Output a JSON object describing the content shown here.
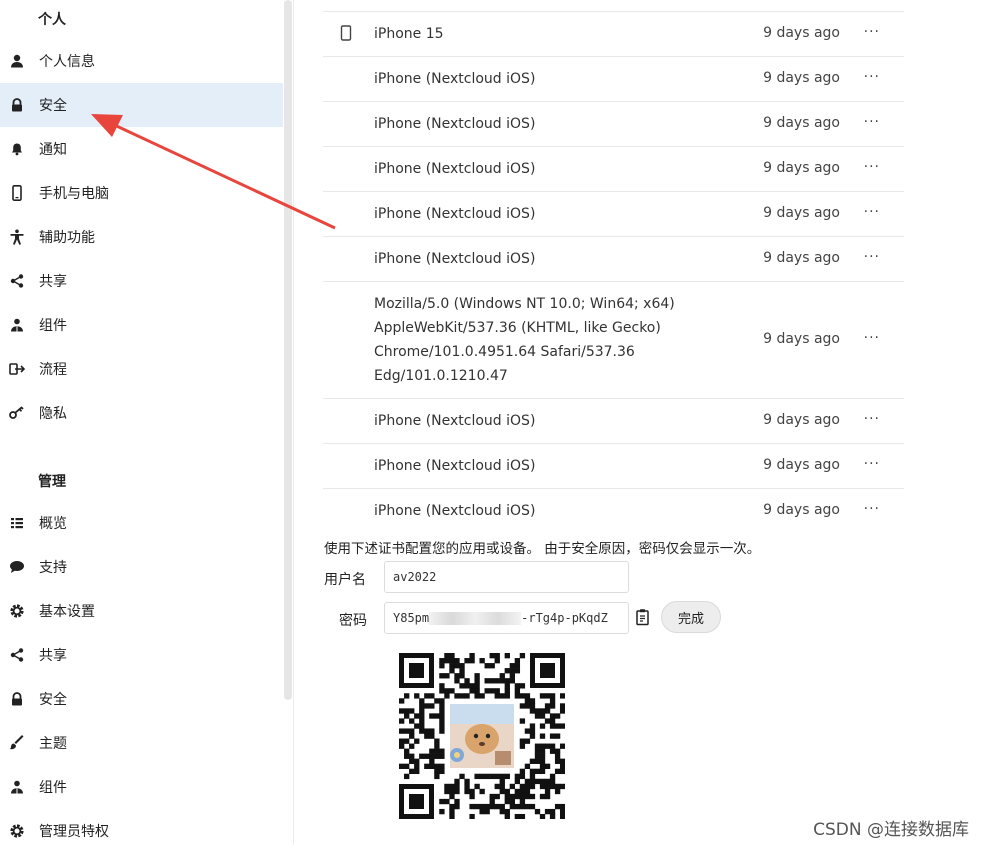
{
  "sidebar": {
    "personal_heading": "个人",
    "personal_items": [
      {
        "label": "个人信息",
        "icon": "user-icon"
      },
      {
        "label": "安全",
        "icon": "lock-icon",
        "active": true
      },
      {
        "label": "通知",
        "icon": "bell-icon"
      },
      {
        "label": "手机与电脑",
        "icon": "phone-icon"
      },
      {
        "label": "辅助功能",
        "icon": "accessibility-icon"
      },
      {
        "label": "共享",
        "icon": "share-icon"
      },
      {
        "label": "组件",
        "icon": "puzzle-icon"
      },
      {
        "label": "流程",
        "icon": "flow-icon"
      },
      {
        "label": "隐私",
        "icon": "key-icon"
      }
    ],
    "admin_heading": "管理",
    "admin_items": [
      {
        "label": "概览",
        "icon": "list-icon"
      },
      {
        "label": "支持",
        "icon": "chat-icon"
      },
      {
        "label": "基本设置",
        "icon": "gear-icon"
      },
      {
        "label": "共享",
        "icon": "share-icon"
      },
      {
        "label": "安全",
        "icon": "lock-icon"
      },
      {
        "label": "主题",
        "icon": "brush-icon"
      },
      {
        "label": "组件",
        "icon": "puzzle-icon"
      },
      {
        "label": "管理员特权",
        "icon": "gear-icon"
      }
    ]
  },
  "sessions": {
    "rows": [
      {
        "name": "iPhone 15",
        "time": "9 days ago",
        "more": "···",
        "icon": "phone-icon"
      },
      {
        "name": "iPhone (Nextcloud iOS)",
        "time": "9 days ago",
        "more": "···"
      },
      {
        "name": "iPhone (Nextcloud iOS)",
        "time": "9 days ago",
        "more": "···"
      },
      {
        "name": "iPhone (Nextcloud iOS)",
        "time": "9 days ago",
        "more": "···"
      },
      {
        "name": "iPhone (Nextcloud iOS)",
        "time": "9 days ago",
        "more": "···"
      },
      {
        "name": "iPhone (Nextcloud iOS)",
        "time": "9 days ago",
        "more": "···"
      },
      {
        "name_lines": [
          "Mozilla/5.0 (Windows NT 10.0; Win64; x64)",
          "AppleWebKit/537.36 (KHTML, like Gecko)",
          "Chrome/101.0.4951.64 Safari/537.36",
          "Edg/101.0.1210.47"
        ],
        "time": "9 days ago",
        "more": "···"
      },
      {
        "name": "iPhone (Nextcloud iOS)",
        "time": "9 days ago",
        "more": "···"
      },
      {
        "name": "iPhone (Nextcloud iOS)",
        "time": "9 days ago",
        "more": "···"
      },
      {
        "name": "iPhone (Nextcloud iOS)",
        "time": "9 days ago",
        "more": "···"
      }
    ]
  },
  "credentials": {
    "instruction": "使用下述证书配置您的应用或设备。 由于安全原因，密码仅会显示一次。",
    "username_label": "用户名",
    "username_value": "av2022",
    "password_label": "密码",
    "password_prefix": "Y85pm",
    "password_suffix": "-rTg4p-pKqdZ",
    "done_label": "完成"
  },
  "watermark": "CSDN @连接数据库",
  "colors": {
    "active_bg": "#e3eef8",
    "arrow": "#e8453c"
  }
}
